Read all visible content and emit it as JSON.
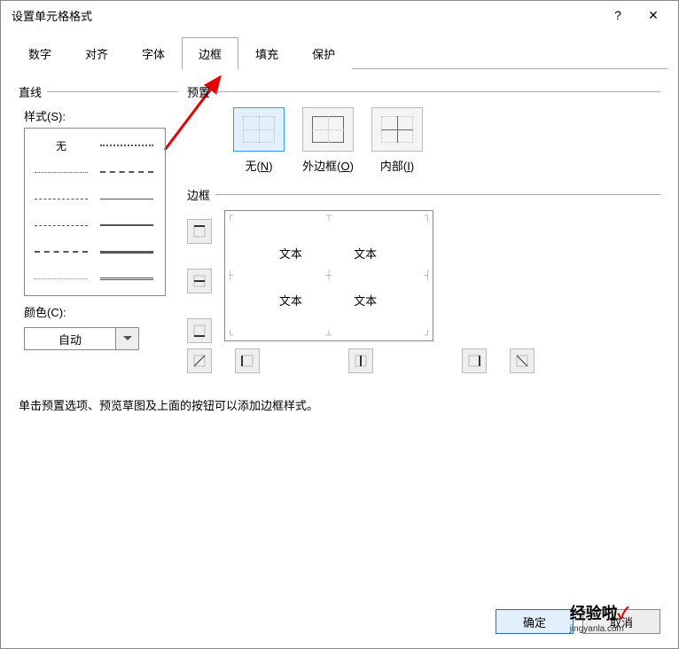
{
  "title": "设置单元格格式",
  "help": "?",
  "close": "✕",
  "tabs": {
    "number": "数字",
    "align": "对齐",
    "font": "字体",
    "border": "边框",
    "fill": "填充",
    "protect": "保护"
  },
  "line": {
    "group": "直线",
    "style_label": "样式(S):",
    "none": "无",
    "color_label": "颜色(C):",
    "color_value": "自动"
  },
  "preset": {
    "group": "预置",
    "none": "无(N)",
    "outline": "外边框(O)",
    "inside": "内部(I)"
  },
  "border": {
    "group": "边框",
    "sample": "文本"
  },
  "hint": "单击预置选项、预览草图及上面的按钮可以添加边框样式。",
  "buttons": {
    "ok": "确定",
    "cancel": "取消"
  },
  "watermark": {
    "main": "经验啦",
    "sub": "jingyanla.com"
  }
}
